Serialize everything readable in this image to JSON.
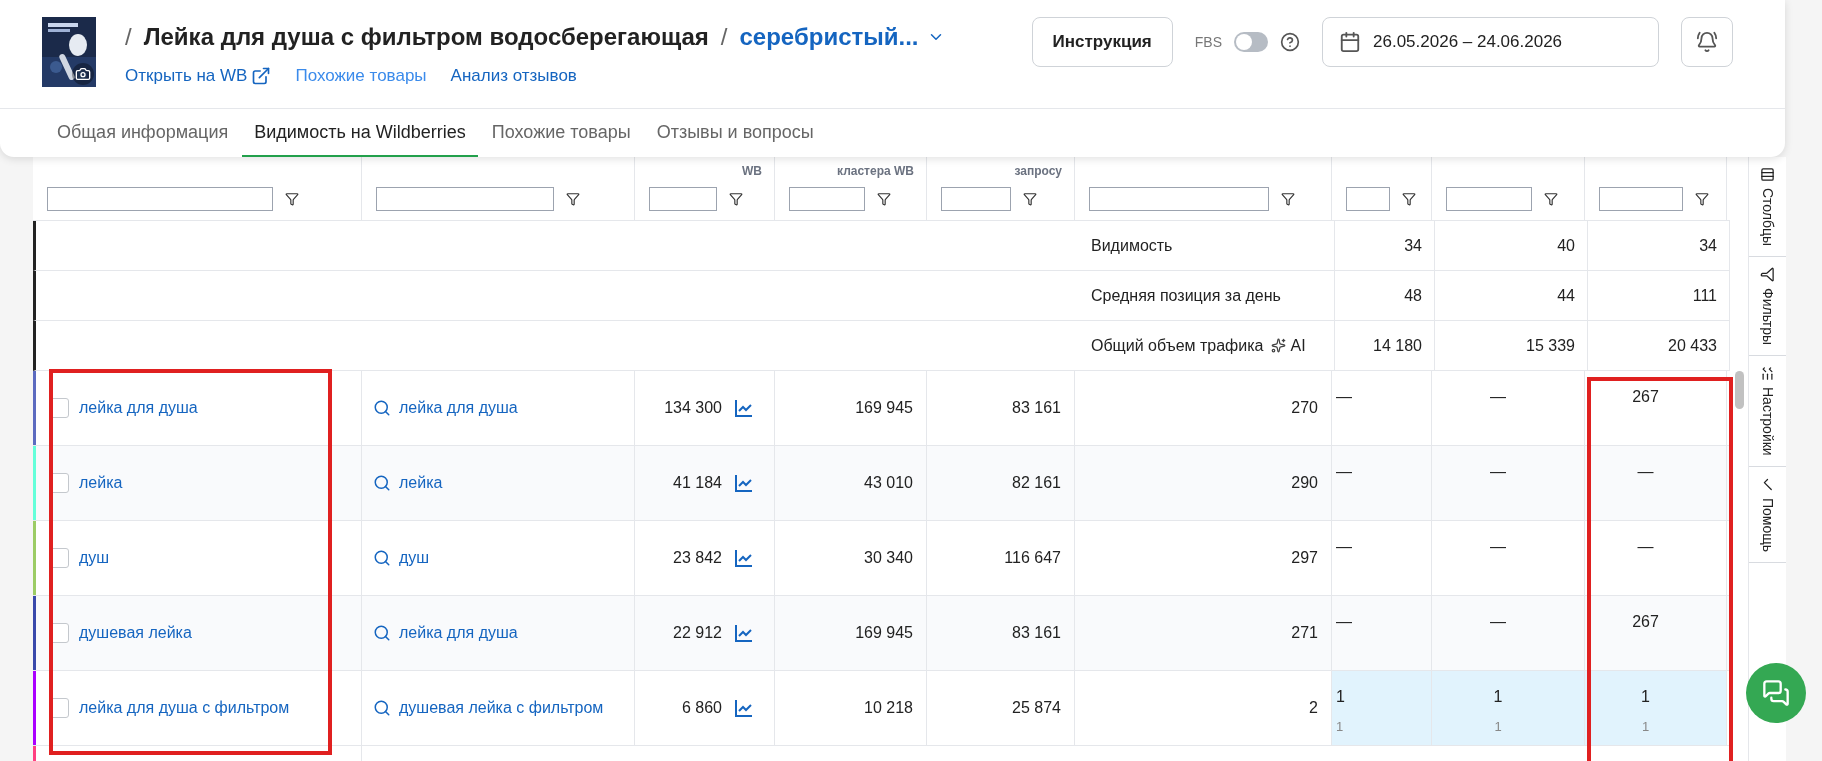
{
  "product": {
    "title_parts": [
      {
        "kind": "separator",
        "text": "/"
      },
      {
        "kind": "title",
        "text": "Лейка для душа с фильтром водосберегающая"
      },
      {
        "kind": "separator",
        "text": "/"
      },
      {
        "kind": "variant",
        "text": "серебристый..."
      }
    ],
    "links": [
      {
        "label": "Открыть на WB",
        "external": true
      },
      {
        "label": "Похожие товары",
        "external": false
      },
      {
        "label": "Анализ отзывов",
        "external": false
      }
    ]
  },
  "actions": {
    "instruction_button": "Инструкция",
    "fbs": {
      "label": "FBS",
      "on": false
    },
    "date_range": "26.05.2026 – 24.06.2026"
  },
  "tabs": [
    {
      "label": "Общая информация",
      "selected": false
    },
    {
      "label": "Видимость на Wildberries",
      "selected": true
    },
    {
      "label": "Похожие товары",
      "selected": false
    },
    {
      "label": "Отзывы и вопросы",
      "selected": false
    }
  ],
  "table": {
    "partial_headers": {
      "column_3": "WB",
      "column_4": "кластера WB",
      "column_5": "запросу"
    },
    "summary_rows": [
      {
        "label": "Видимость",
        "ai": null,
        "values": [
          "34",
          "40",
          "34"
        ]
      },
      {
        "label": "Средняя позиция за день",
        "ai": null,
        "values": [
          "48",
          "44",
          "111"
        ]
      },
      {
        "label": "Общий объем трафика",
        "ai": "AI",
        "values": [
          "14 180",
          "15 339",
          "20 433"
        ]
      }
    ],
    "rows": [
      {
        "color": "#5c6bc0",
        "checked": false,
        "highlighted": false,
        "query": "лейка для душа",
        "cluster": "лейка для душа",
        "cells": [
          "134 300",
          "169 945",
          "83 161",
          "270"
        ],
        "positions": [
          {
            "value": "—"
          },
          {
            "value": "—"
          },
          {
            "value": "267"
          }
        ]
      },
      {
        "color": "#64ffda",
        "checked": false,
        "highlighted": false,
        "query": "лейка",
        "cluster": "лейка",
        "cells": [
          "41 184",
          "43 010",
          "82 161",
          "290"
        ],
        "positions": [
          {
            "value": "—"
          },
          {
            "value": "—"
          },
          {
            "value": "—"
          }
        ]
      },
      {
        "color": "#9ccc65",
        "checked": false,
        "highlighted": false,
        "query": "душ",
        "cluster": "душ",
        "cells": [
          "23 842",
          "30 340",
          "116 647",
          "297"
        ],
        "positions": [
          {
            "value": "—"
          },
          {
            "value": "—"
          },
          {
            "value": "—"
          }
        ]
      },
      {
        "color": "#3949ab",
        "checked": false,
        "highlighted": false,
        "query": "душевая лейка",
        "cluster": "лейка для душа",
        "cells": [
          "22 912",
          "169 945",
          "83 161",
          "271"
        ],
        "positions": [
          {
            "value": "—"
          },
          {
            "value": "—"
          },
          {
            "value": "267"
          }
        ]
      },
      {
        "color": "#aa00ff",
        "checked": false,
        "highlighted": true,
        "query": "лейка для душа с фильтром",
        "cluster": "душевая лейка с фильтром",
        "cells": [
          "6 860",
          "10 218",
          "25 874",
          "2"
        ],
        "positions": [
          {
            "value": "1",
            "sub": "1"
          },
          {
            "value": "1",
            "sub": "1"
          },
          {
            "value": "1",
            "sub": "1"
          }
        ]
      }
    ],
    "cut_row": {
      "color": "#ff4081"
    }
  },
  "side_panel": [
    {
      "kind": "columns",
      "label": "Столбцы"
    },
    {
      "kind": "filters",
      "label": "Фильтры"
    },
    {
      "kind": "settings",
      "label": "Настройки"
    },
    {
      "kind": "help",
      "label": "Помощь"
    }
  ]
}
